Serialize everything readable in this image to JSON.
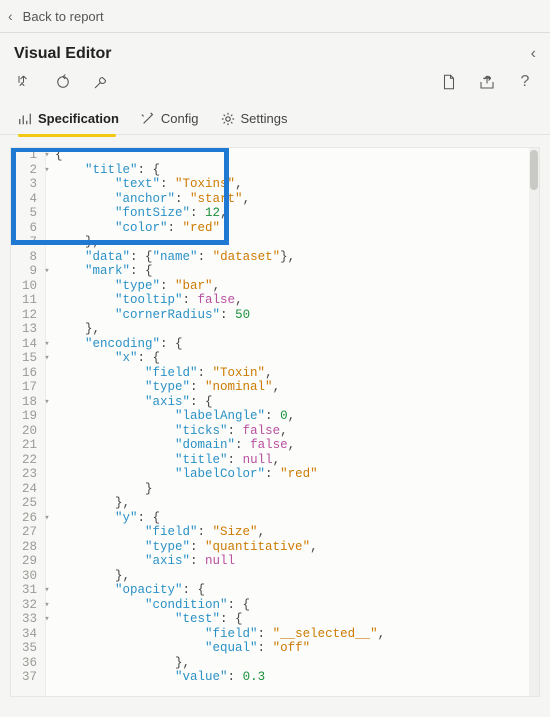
{
  "topbar": {
    "back_label": "Back to report"
  },
  "header": {
    "title": "Visual Editor"
  },
  "tabs": {
    "spec": "Specification",
    "config": "Config",
    "settings": "Settings"
  },
  "code": {
    "lines": [
      {
        "n": 1,
        "fold": true,
        "indent": 0,
        "tokens": [
          {
            "t": "p",
            "v": "{"
          }
        ]
      },
      {
        "n": 2,
        "fold": true,
        "indent": 2,
        "tokens": [
          {
            "t": "key",
            "v": "\"title\""
          },
          {
            "t": "p",
            "v": ": {"
          }
        ]
      },
      {
        "n": 3,
        "fold": false,
        "indent": 4,
        "tokens": [
          {
            "t": "key",
            "v": "\"text\""
          },
          {
            "t": "p",
            "v": ": "
          },
          {
            "t": "str",
            "v": "\"Toxins\""
          },
          {
            "t": "p",
            "v": ","
          }
        ]
      },
      {
        "n": 4,
        "fold": false,
        "indent": 4,
        "tokens": [
          {
            "t": "key",
            "v": "\"anchor\""
          },
          {
            "t": "p",
            "v": ": "
          },
          {
            "t": "str",
            "v": "\"start\""
          },
          {
            "t": "p",
            "v": ","
          }
        ]
      },
      {
        "n": 5,
        "fold": false,
        "indent": 4,
        "tokens": [
          {
            "t": "key",
            "v": "\"fontSize\""
          },
          {
            "t": "p",
            "v": ": "
          },
          {
            "t": "num",
            "v": "12"
          },
          {
            "t": "p",
            "v": ","
          }
        ]
      },
      {
        "n": 6,
        "fold": false,
        "indent": 4,
        "tokens": [
          {
            "t": "key",
            "v": "\"color\""
          },
          {
            "t": "p",
            "v": ": "
          },
          {
            "t": "str",
            "v": "\"red\""
          }
        ]
      },
      {
        "n": 7,
        "fold": false,
        "indent": 2,
        "tokens": [
          {
            "t": "p",
            "v": "},"
          }
        ]
      },
      {
        "n": 8,
        "fold": false,
        "indent": 2,
        "tokens": [
          {
            "t": "key",
            "v": "\"data\""
          },
          {
            "t": "p",
            "v": ": {"
          },
          {
            "t": "key",
            "v": "\"name\""
          },
          {
            "t": "p",
            "v": ": "
          },
          {
            "t": "str",
            "v": "\"dataset\""
          },
          {
            "t": "p",
            "v": "},"
          }
        ]
      },
      {
        "n": 9,
        "fold": true,
        "indent": 2,
        "tokens": [
          {
            "t": "key",
            "v": "\"mark\""
          },
          {
            "t": "p",
            "v": ": {"
          }
        ]
      },
      {
        "n": 10,
        "fold": false,
        "indent": 4,
        "tokens": [
          {
            "t": "key",
            "v": "\"type\""
          },
          {
            "t": "p",
            "v": ": "
          },
          {
            "t": "str",
            "v": "\"bar\""
          },
          {
            "t": "p",
            "v": ","
          }
        ]
      },
      {
        "n": 11,
        "fold": false,
        "indent": 4,
        "tokens": [
          {
            "t": "key",
            "v": "\"tooltip\""
          },
          {
            "t": "p",
            "v": ": "
          },
          {
            "t": "kw",
            "v": "false"
          },
          {
            "t": "p",
            "v": ","
          }
        ]
      },
      {
        "n": 12,
        "fold": false,
        "indent": 4,
        "tokens": [
          {
            "t": "key",
            "v": "\"cornerRadius\""
          },
          {
            "t": "p",
            "v": ": "
          },
          {
            "t": "num",
            "v": "50"
          }
        ]
      },
      {
        "n": 13,
        "fold": false,
        "indent": 2,
        "tokens": [
          {
            "t": "p",
            "v": "},"
          }
        ]
      },
      {
        "n": 14,
        "fold": true,
        "indent": 2,
        "tokens": [
          {
            "t": "key",
            "v": "\"encoding\""
          },
          {
            "t": "p",
            "v": ": {"
          }
        ]
      },
      {
        "n": 15,
        "fold": true,
        "indent": 4,
        "tokens": [
          {
            "t": "key",
            "v": "\"x\""
          },
          {
            "t": "p",
            "v": ": {"
          }
        ]
      },
      {
        "n": 16,
        "fold": false,
        "indent": 6,
        "tokens": [
          {
            "t": "key",
            "v": "\"field\""
          },
          {
            "t": "p",
            "v": ": "
          },
          {
            "t": "str",
            "v": "\"Toxin\""
          },
          {
            "t": "p",
            "v": ","
          }
        ]
      },
      {
        "n": 17,
        "fold": false,
        "indent": 6,
        "tokens": [
          {
            "t": "key",
            "v": "\"type\""
          },
          {
            "t": "p",
            "v": ": "
          },
          {
            "t": "str",
            "v": "\"nominal\""
          },
          {
            "t": "p",
            "v": ","
          }
        ]
      },
      {
        "n": 18,
        "fold": true,
        "indent": 6,
        "tokens": [
          {
            "t": "key",
            "v": "\"axis\""
          },
          {
            "t": "p",
            "v": ": {"
          }
        ]
      },
      {
        "n": 19,
        "fold": false,
        "indent": 8,
        "tokens": [
          {
            "t": "key",
            "v": "\"labelAngle\""
          },
          {
            "t": "p",
            "v": ": "
          },
          {
            "t": "num",
            "v": "0"
          },
          {
            "t": "p",
            "v": ","
          }
        ]
      },
      {
        "n": 20,
        "fold": false,
        "indent": 8,
        "tokens": [
          {
            "t": "key",
            "v": "\"ticks\""
          },
          {
            "t": "p",
            "v": ": "
          },
          {
            "t": "kw",
            "v": "false"
          },
          {
            "t": "p",
            "v": ","
          }
        ]
      },
      {
        "n": 21,
        "fold": false,
        "indent": 8,
        "tokens": [
          {
            "t": "key",
            "v": "\"domain\""
          },
          {
            "t": "p",
            "v": ": "
          },
          {
            "t": "kw",
            "v": "false"
          },
          {
            "t": "p",
            "v": ","
          }
        ]
      },
      {
        "n": 22,
        "fold": false,
        "indent": 8,
        "tokens": [
          {
            "t": "key",
            "v": "\"title\""
          },
          {
            "t": "p",
            "v": ": "
          },
          {
            "t": "kw",
            "v": "null"
          },
          {
            "t": "p",
            "v": ","
          }
        ]
      },
      {
        "n": 23,
        "fold": false,
        "indent": 8,
        "tokens": [
          {
            "t": "key",
            "v": "\"labelColor\""
          },
          {
            "t": "p",
            "v": ": "
          },
          {
            "t": "str",
            "v": "\"red\""
          }
        ]
      },
      {
        "n": 24,
        "fold": false,
        "indent": 6,
        "tokens": [
          {
            "t": "p",
            "v": "}"
          }
        ]
      },
      {
        "n": 25,
        "fold": false,
        "indent": 4,
        "tokens": [
          {
            "t": "p",
            "v": "},"
          }
        ]
      },
      {
        "n": 26,
        "fold": true,
        "indent": 4,
        "tokens": [
          {
            "t": "key",
            "v": "\"y\""
          },
          {
            "t": "p",
            "v": ": {"
          }
        ]
      },
      {
        "n": 27,
        "fold": false,
        "indent": 6,
        "tokens": [
          {
            "t": "key",
            "v": "\"field\""
          },
          {
            "t": "p",
            "v": ": "
          },
          {
            "t": "str",
            "v": "\"Size\""
          },
          {
            "t": "p",
            "v": ","
          }
        ]
      },
      {
        "n": 28,
        "fold": false,
        "indent": 6,
        "tokens": [
          {
            "t": "key",
            "v": "\"type\""
          },
          {
            "t": "p",
            "v": ": "
          },
          {
            "t": "str",
            "v": "\"quantitative\""
          },
          {
            "t": "p",
            "v": ","
          }
        ]
      },
      {
        "n": 29,
        "fold": false,
        "indent": 6,
        "tokens": [
          {
            "t": "key",
            "v": "\"axis\""
          },
          {
            "t": "p",
            "v": ": "
          },
          {
            "t": "kw",
            "v": "null"
          }
        ]
      },
      {
        "n": 30,
        "fold": false,
        "indent": 4,
        "tokens": [
          {
            "t": "p",
            "v": "},"
          }
        ]
      },
      {
        "n": 31,
        "fold": true,
        "indent": 4,
        "tokens": [
          {
            "t": "key",
            "v": "\"opacity\""
          },
          {
            "t": "p",
            "v": ": {"
          }
        ]
      },
      {
        "n": 32,
        "fold": true,
        "indent": 6,
        "tokens": [
          {
            "t": "key",
            "v": "\"condition\""
          },
          {
            "t": "p",
            "v": ": {"
          }
        ]
      },
      {
        "n": 33,
        "fold": true,
        "indent": 8,
        "tokens": [
          {
            "t": "key",
            "v": "\"test\""
          },
          {
            "t": "p",
            "v": ": {"
          }
        ]
      },
      {
        "n": 34,
        "fold": false,
        "indent": 10,
        "tokens": [
          {
            "t": "key",
            "v": "\"field\""
          },
          {
            "t": "p",
            "v": ": "
          },
          {
            "t": "str",
            "v": "\"__selected__\""
          },
          {
            "t": "p",
            "v": ","
          }
        ]
      },
      {
        "n": 35,
        "fold": false,
        "indent": 10,
        "tokens": [
          {
            "t": "key",
            "v": "\"equal\""
          },
          {
            "t": "p",
            "v": ": "
          },
          {
            "t": "str",
            "v": "\"off\""
          }
        ]
      },
      {
        "n": 36,
        "fold": false,
        "indent": 8,
        "tokens": [
          {
            "t": "p",
            "v": "},"
          }
        ]
      },
      {
        "n": 37,
        "fold": false,
        "indent": 8,
        "tokens": [
          {
            "t": "key",
            "v": "\"value\""
          },
          {
            "t": "p",
            "v": ": "
          },
          {
            "t": "num",
            "v": "0.3"
          }
        ]
      }
    ]
  }
}
